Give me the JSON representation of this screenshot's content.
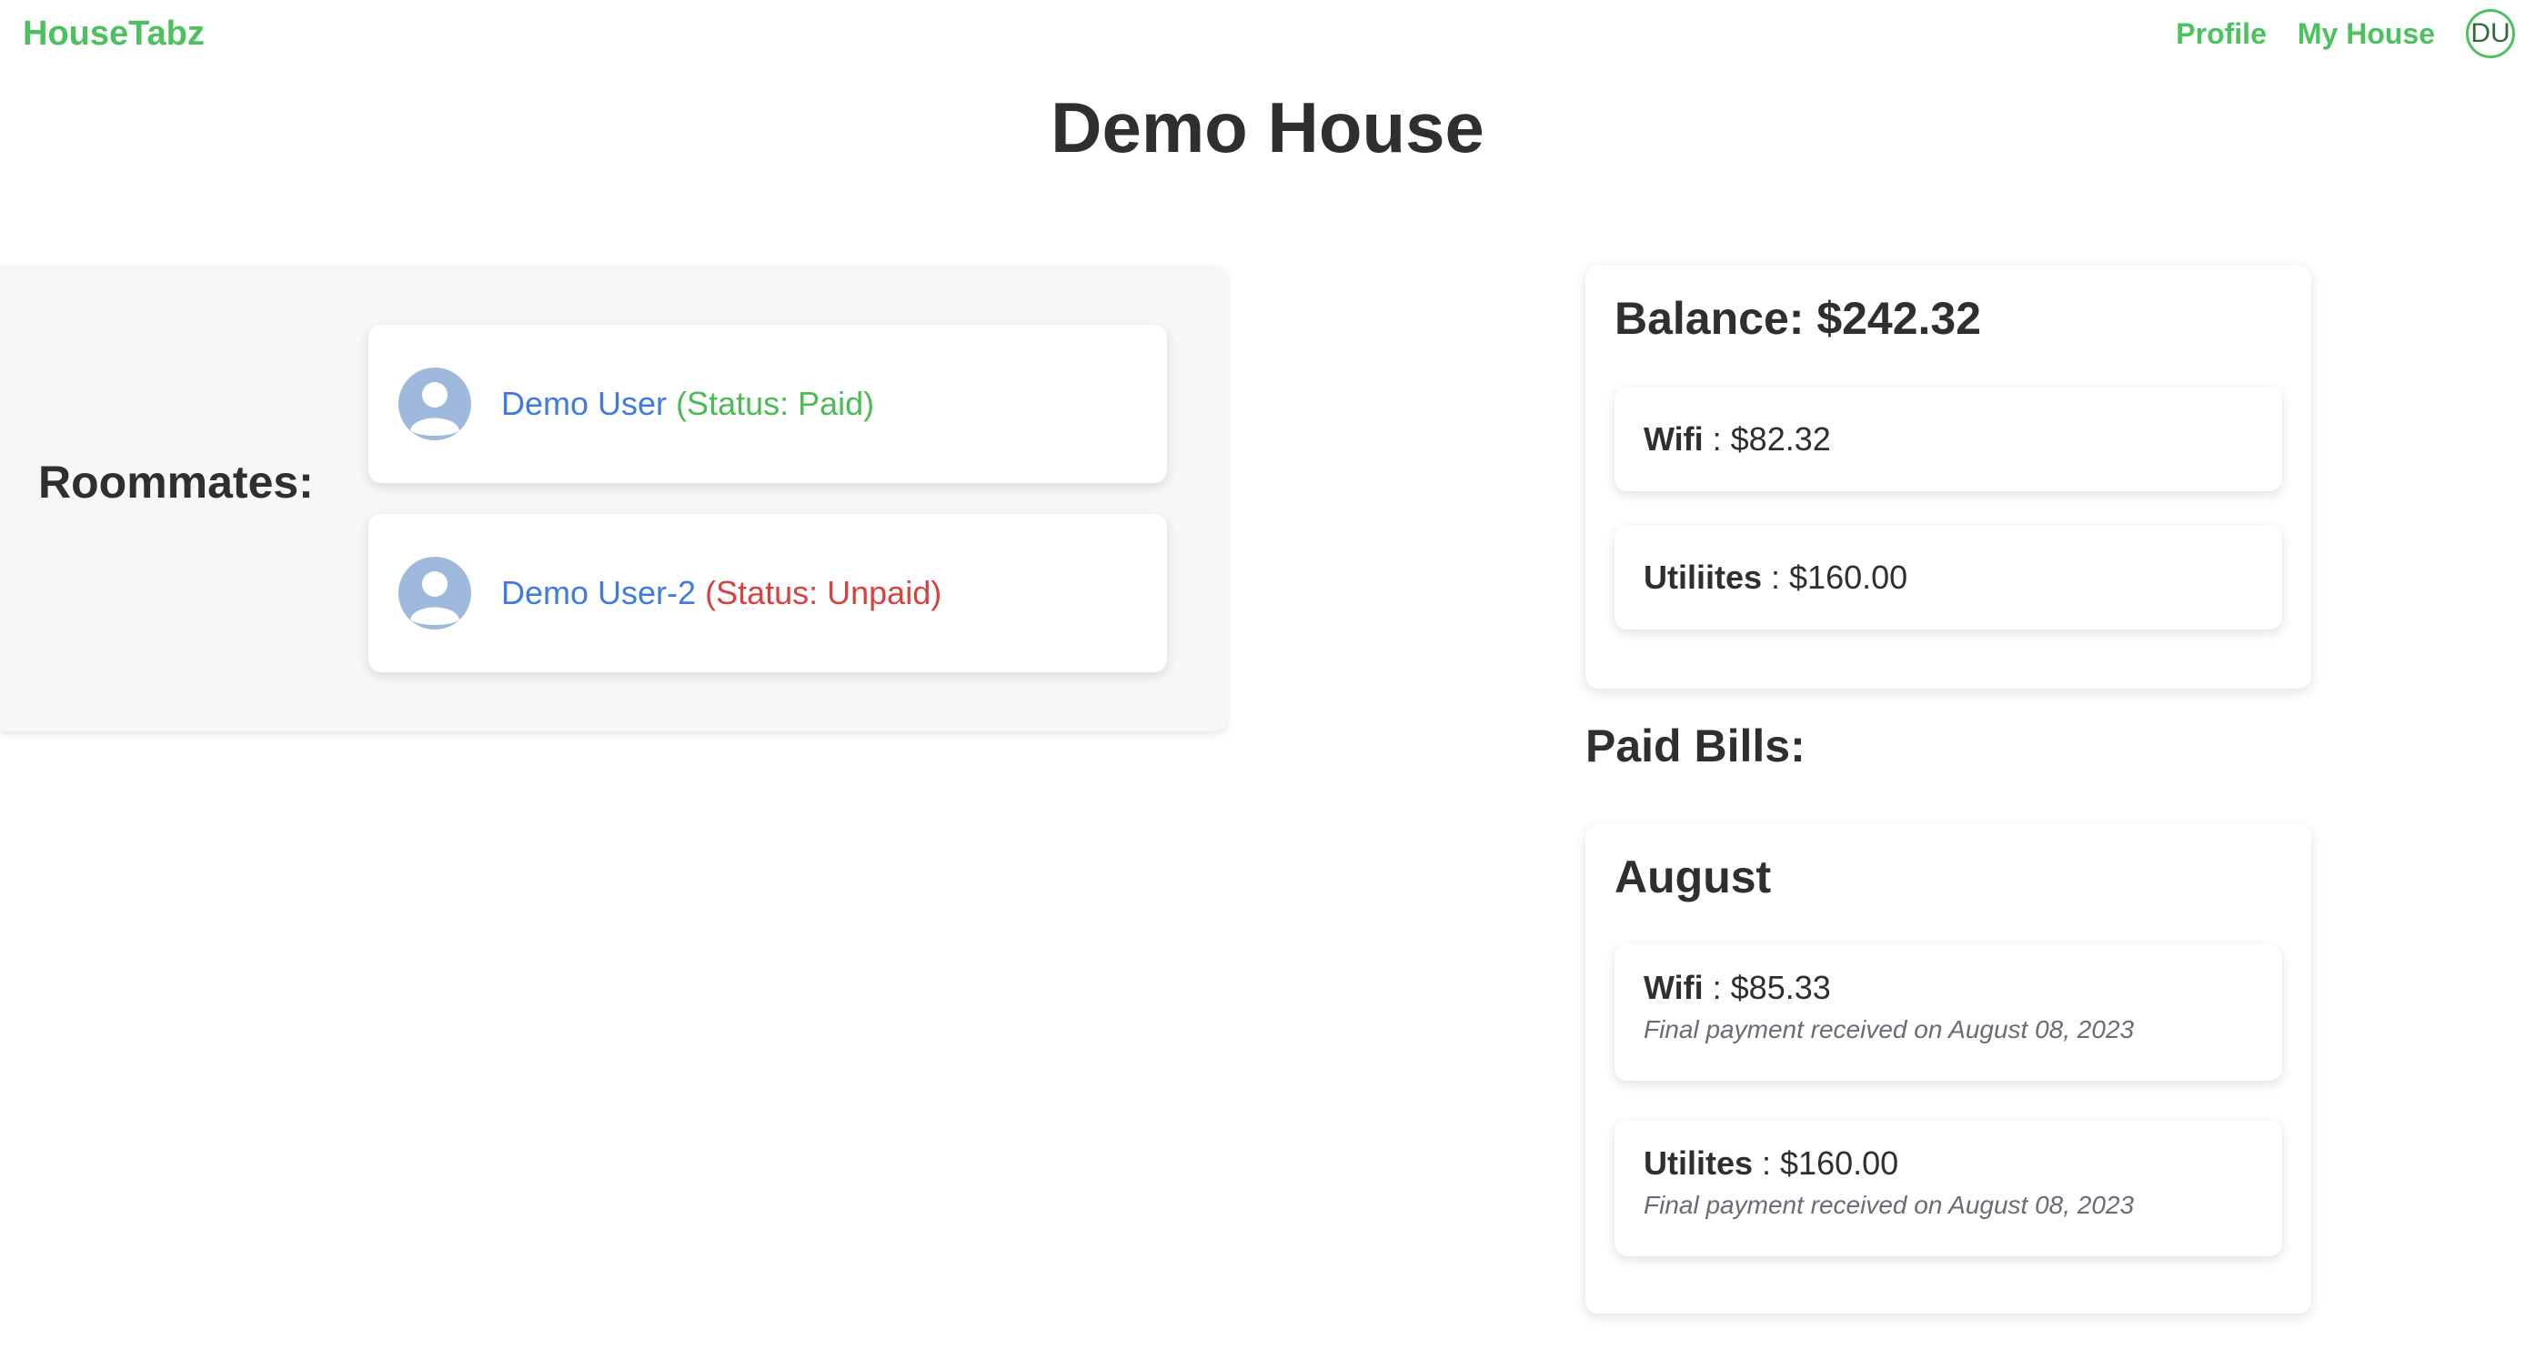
{
  "nav": {
    "brand": "HouseTabz",
    "links": [
      "Profile",
      "My House"
    ],
    "avatar_initials": "DU"
  },
  "page": {
    "title": "Demo House"
  },
  "roommates": {
    "label": "Roommates:",
    "items": [
      {
        "name": "Demo User",
        "status": "(Status: Paid)",
        "icon": "user-avatar-icon"
      },
      {
        "name": "Demo User-2",
        "status": "(Status: Unpaid)",
        "icon": "user-avatar-icon"
      }
    ]
  },
  "balance": {
    "title": "Balance: $242.32",
    "bills": [
      {
        "name": "Wifi",
        "amount": " : $82.32"
      },
      {
        "name": "Utiliites",
        "amount": " : $160.00"
      }
    ]
  },
  "paid_bills": {
    "label": "Paid Bills:",
    "months": [
      {
        "month": "August",
        "bills": [
          {
            "name": "Wifi",
            "amount": " : $85.33",
            "note": "Final payment received on August 08, 2023"
          },
          {
            "name": "Utilites",
            "amount": " : $160.00",
            "note": "Final payment received on August 08, 2023"
          }
        ]
      }
    ]
  },
  "colors": {
    "brand_green": "#4cc15e",
    "name_blue": "#3f7be0",
    "paid_green": "#4cbb55",
    "unpaid_red": "#d94141",
    "avatar_blue": "#9fb9dc"
  }
}
